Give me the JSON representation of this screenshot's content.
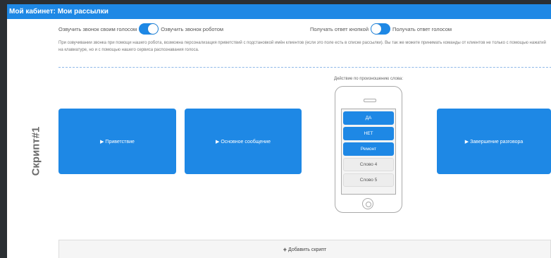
{
  "header": {
    "title": "Мой кабинет: Мои рассылки"
  },
  "voice_toggle": {
    "left_label": "Озвучить звонок своим голосом",
    "right_label": "Озвучить звонок роботом",
    "state": "right"
  },
  "reply_toggle": {
    "left_label": "Получать ответ кнопкой",
    "right_label": "Получать ответ голосом",
    "state": "left"
  },
  "description": "При озвучивании звонка при помощи нашего робота, возможна персонализация приветствий с подстановкой имён клиентов (если это поле есть в списке рассылки). Вы так же можете принимать команды от клиентов не только с помощью нажатий на клавиатуре, но и с помощью нашего сервиса распознавания голоса.",
  "script": {
    "label": "Скрипт#1",
    "blocks": [
      "▶ Приветствие",
      "▶ Основное сообщение",
      "▶ Завершение разговора"
    ],
    "phone_caption": "Действие по произношению слова:",
    "words": [
      {
        "label": "ДА",
        "active": true
      },
      {
        "label": "НЕТ",
        "active": true
      },
      {
        "label": "Ремонт",
        "active": true
      },
      {
        "label": "Слово 4",
        "active": false
      },
      {
        "label": "Слово 5",
        "active": false
      }
    ]
  },
  "add_script": {
    "icon": "+",
    "label": "Добавить скрипт"
  },
  "colors": {
    "accent": "#1e88e5",
    "background": "#ffffff",
    "sidebar": "#2b2f33"
  }
}
